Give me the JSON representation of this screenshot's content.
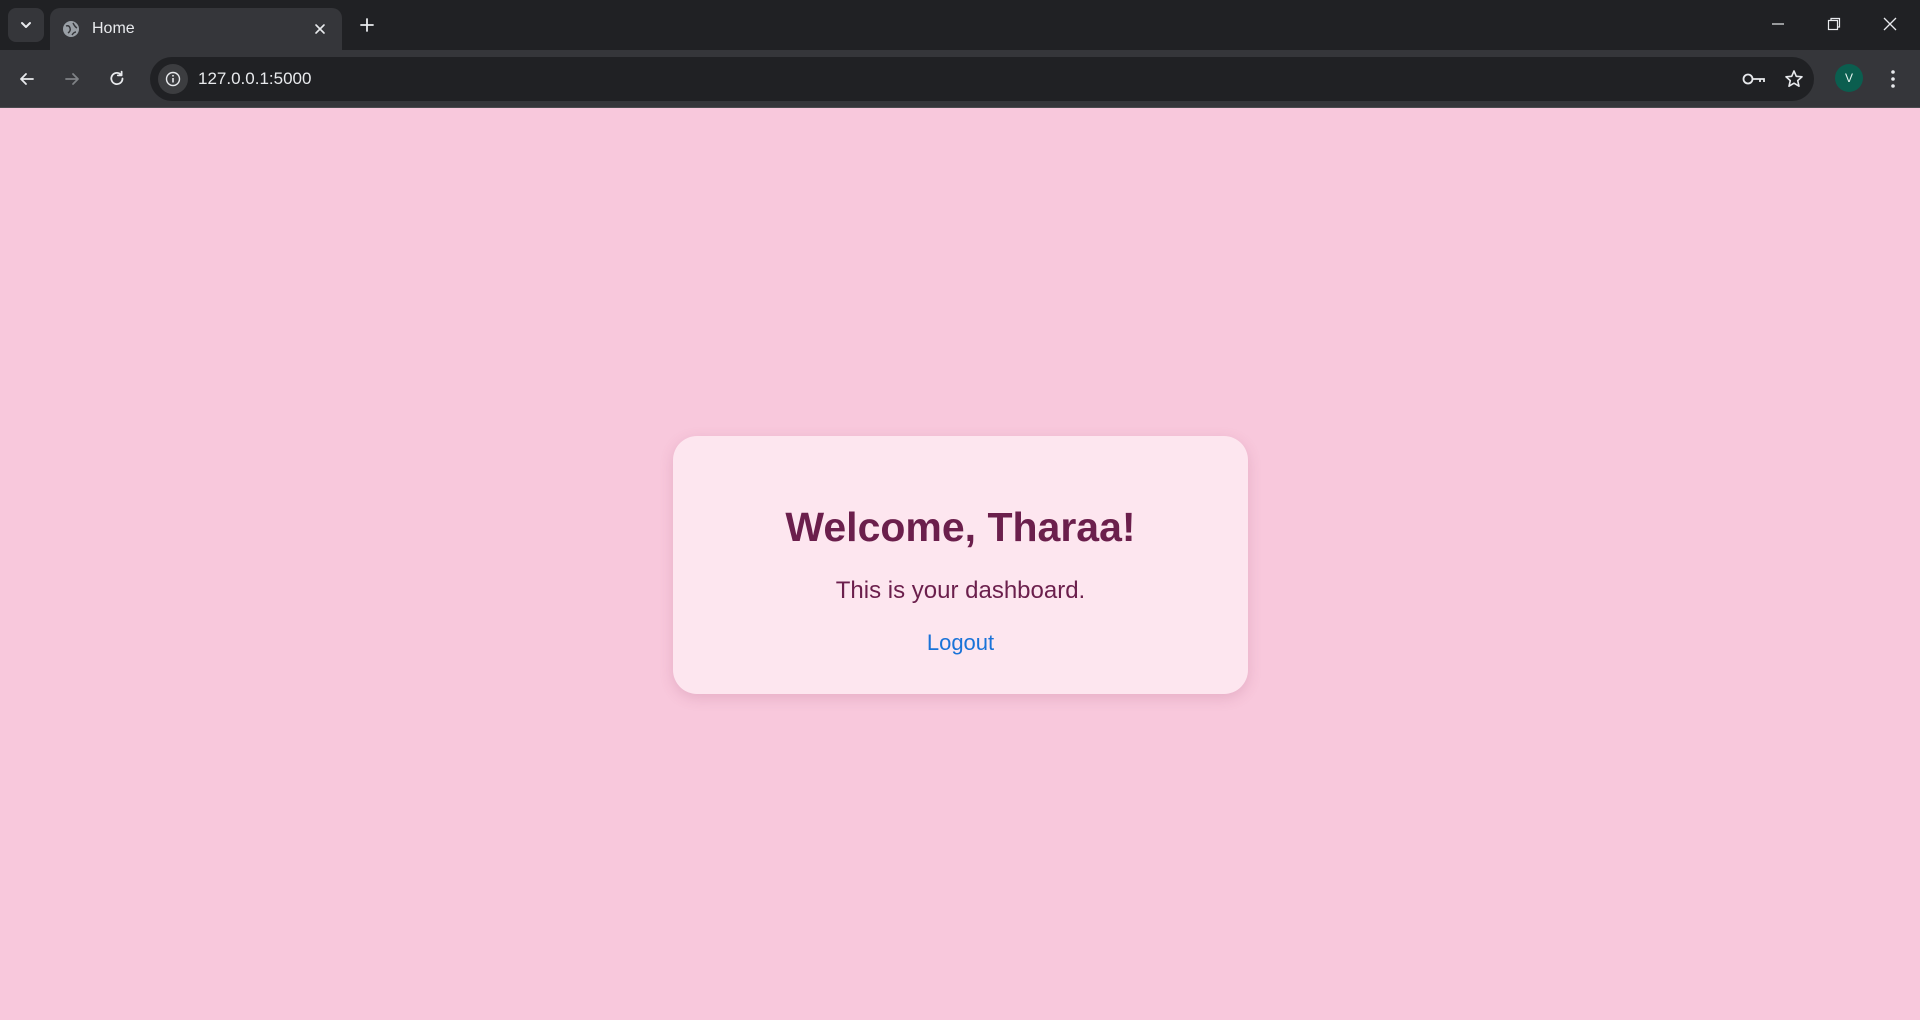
{
  "browser": {
    "tab": {
      "title": "Home",
      "favicon": "globe-icon"
    },
    "url": "127.0.0.1:5000",
    "profile_initial": "V",
    "icons": {
      "tab_search": "chevron-down-icon",
      "close_tab": "close-icon",
      "new_tab": "plus-icon",
      "back": "arrow-left-icon",
      "forward": "arrow-right-icon",
      "reload": "reload-icon",
      "site_info": "info-icon",
      "passwords": "key-icon",
      "bookmark": "star-icon",
      "menu": "kebab-menu-icon",
      "minimize": "minimize-icon",
      "restore": "restore-icon",
      "close_window": "close-icon"
    }
  },
  "page": {
    "heading": "Welcome, Tharaa!",
    "subtitle": "This is your dashboard.",
    "logout_label": "Logout"
  },
  "colors": {
    "page_background": "#f8c8dc",
    "card_background": "#fde6ef",
    "heading": "#6b1f4c",
    "link": "#1a73d8",
    "chrome_dark": "#202124",
    "chrome_toolbar": "#35363a"
  }
}
